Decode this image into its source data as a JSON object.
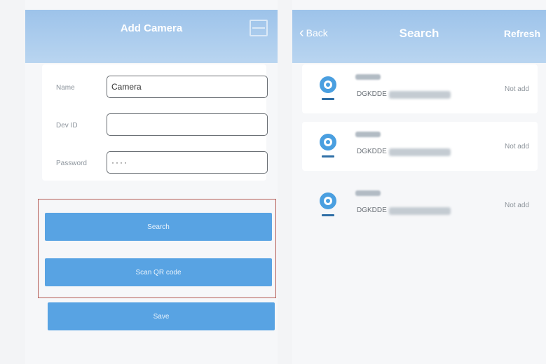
{
  "add_camera": {
    "title": "Add Camera",
    "fields": [
      {
        "label": "Name",
        "value": "Camera"
      },
      {
        "label": "Dev ID",
        "value": ""
      },
      {
        "label": "Password",
        "value": "····"
      }
    ],
    "buttons": {
      "search": "Search",
      "scan_qr": "Scan QR code",
      "save": "Save"
    }
  },
  "search_screen": {
    "back": "Back",
    "title": "Search",
    "refresh": "Refresh",
    "devices": [
      {
        "id_prefix": "DGKDDE",
        "status": "Not add"
      },
      {
        "id_prefix": "DGKDDE",
        "status": "Not add"
      },
      {
        "id_prefix": "DGKDDE",
        "status": "Not add"
      }
    ]
  },
  "colors": {
    "nav_bar": "#a9cbed",
    "button": "#58a3e3",
    "highlight_border": "#b45c55",
    "camera_icon": "#4a9fe0"
  }
}
